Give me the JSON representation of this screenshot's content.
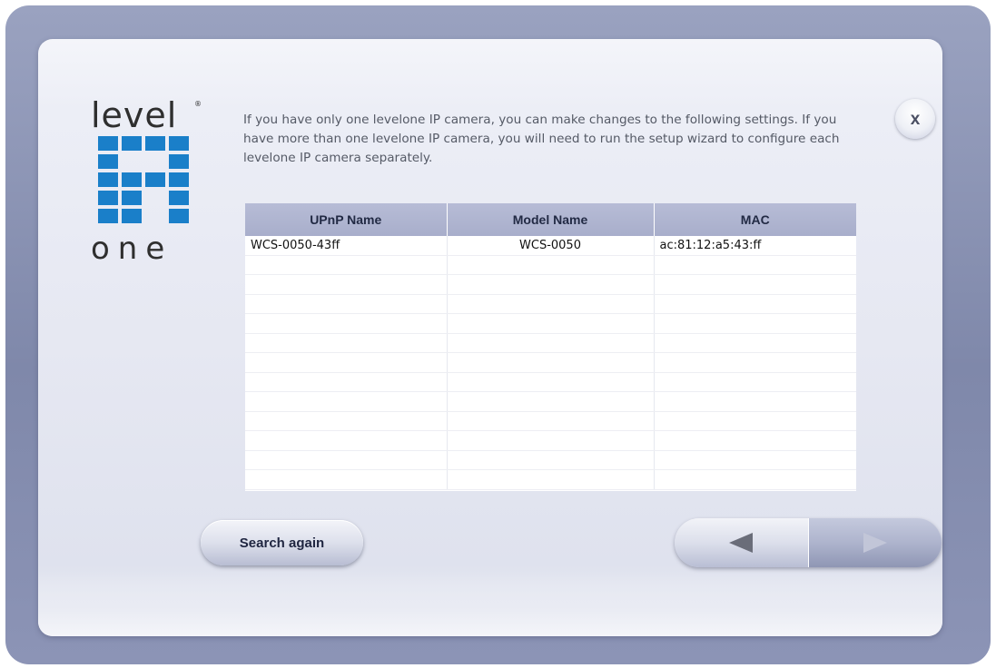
{
  "logo": {
    "top_text": "level",
    "registered_mark": "®",
    "bottom_text": "one",
    "color": "#1a7fc9"
  },
  "intro_text": "If you have only one levelone IP camera, you can make changes to the following settings. If you have more than one levelone IP camera, you will need to run the setup wizard to configure each levelone IP camera separately.",
  "close_button": {
    "label": "x",
    "icon": "close-icon"
  },
  "table": {
    "columns": [
      "UPnP Name",
      "Model Name",
      "MAC"
    ],
    "rows": [
      [
        "WCS-0050-43ff",
        "WCS-0050",
        "ac:81:12:a5:43:ff"
      ],
      [
        "",
        "",
        ""
      ],
      [
        "",
        "",
        ""
      ],
      [
        "",
        "",
        ""
      ],
      [
        "",
        "",
        ""
      ],
      [
        "",
        "",
        ""
      ],
      [
        "",
        "",
        ""
      ],
      [
        "",
        "",
        ""
      ],
      [
        "",
        "",
        ""
      ],
      [
        "",
        "",
        ""
      ],
      [
        "",
        "",
        ""
      ],
      [
        "",
        "",
        ""
      ],
      [
        "",
        "",
        ""
      ]
    ]
  },
  "buttons": {
    "search_again": "Search again",
    "back_icon": "arrow-left-icon",
    "next_icon": "arrow-right-icon"
  },
  "colors": {
    "header_bg": "#aab0cd",
    "frame": "#8a92b3",
    "logo_blue": "#1a7fc9"
  }
}
